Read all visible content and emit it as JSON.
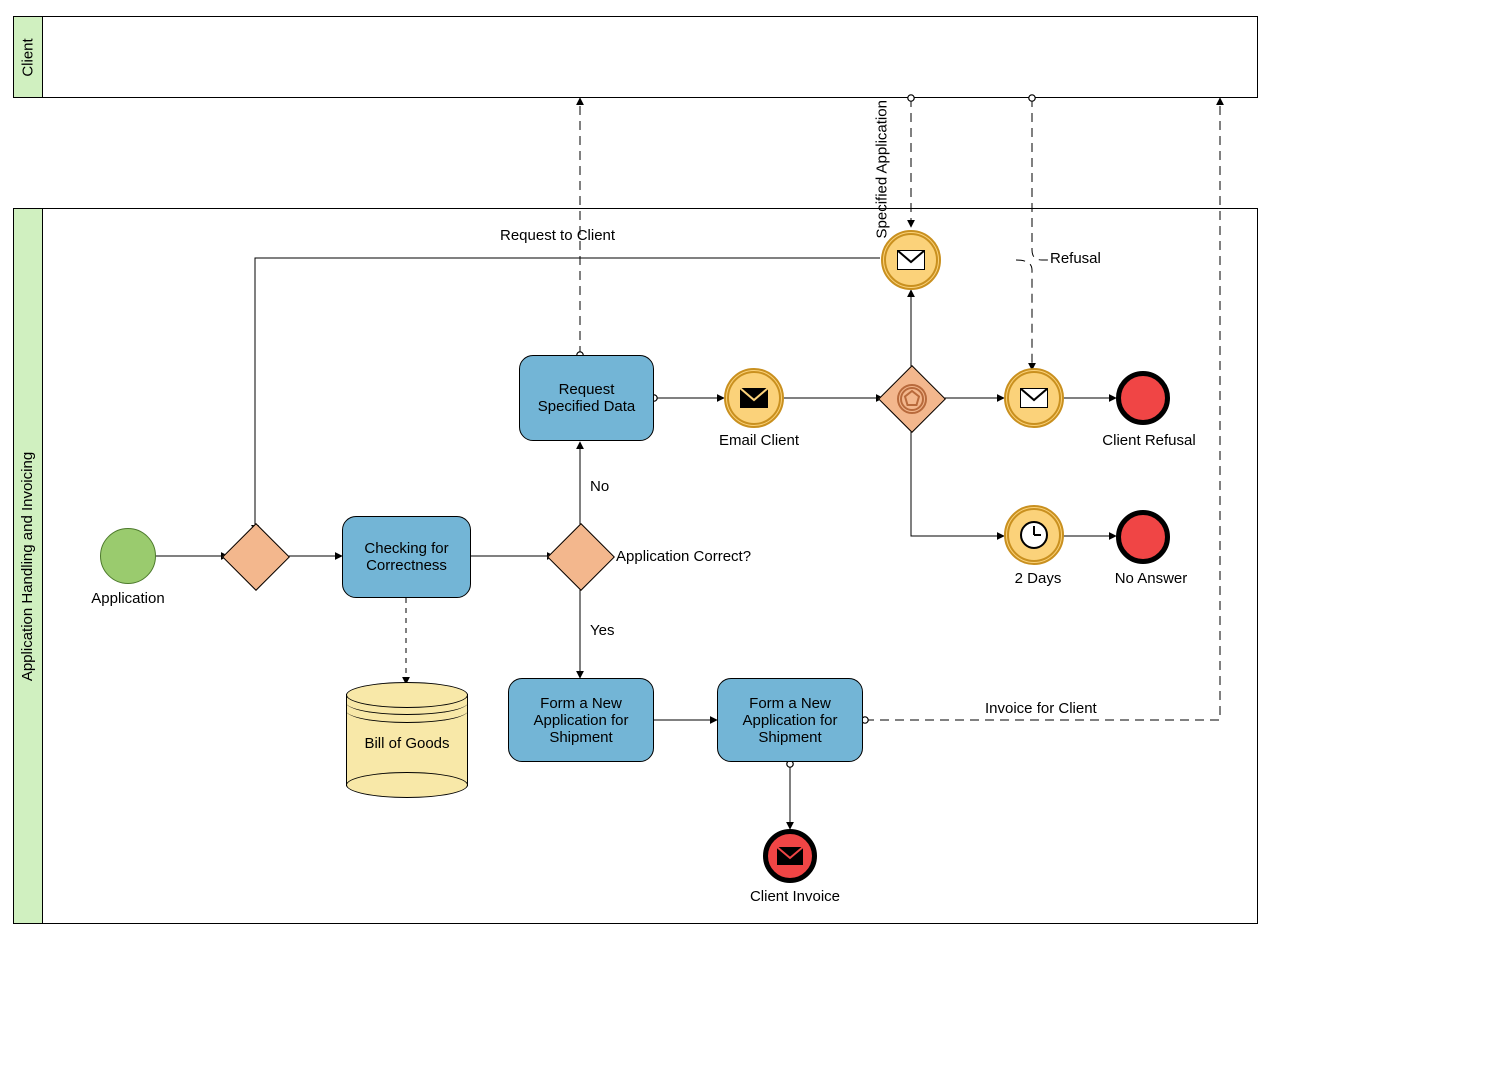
{
  "lanes": {
    "client": "Client",
    "app": "Application Handling and Invoicing"
  },
  "nodes": {
    "start_application": "Application",
    "task_checking": "Checking for Correctness",
    "task_request": "Request Specified Data",
    "task_form1": "Form a New Application for Shipment",
    "task_form2": "Form a New Application for Shipment",
    "event_email_client": "Email Client",
    "event_2days": "2 Days",
    "end_client_refusal": "Client Refusal",
    "end_no_answer": "No Answer",
    "end_client_invoice": "Client Invoice",
    "data_bill": "Bill of Goods"
  },
  "labels": {
    "gateway_q": "Application Correct?",
    "branch_yes": "Yes",
    "branch_no": "No",
    "msg_request": "Request to Client",
    "msg_spec_app": "Specified Application",
    "msg_refusal": "Refusal",
    "msg_invoice": "Invoice for Client"
  }
}
